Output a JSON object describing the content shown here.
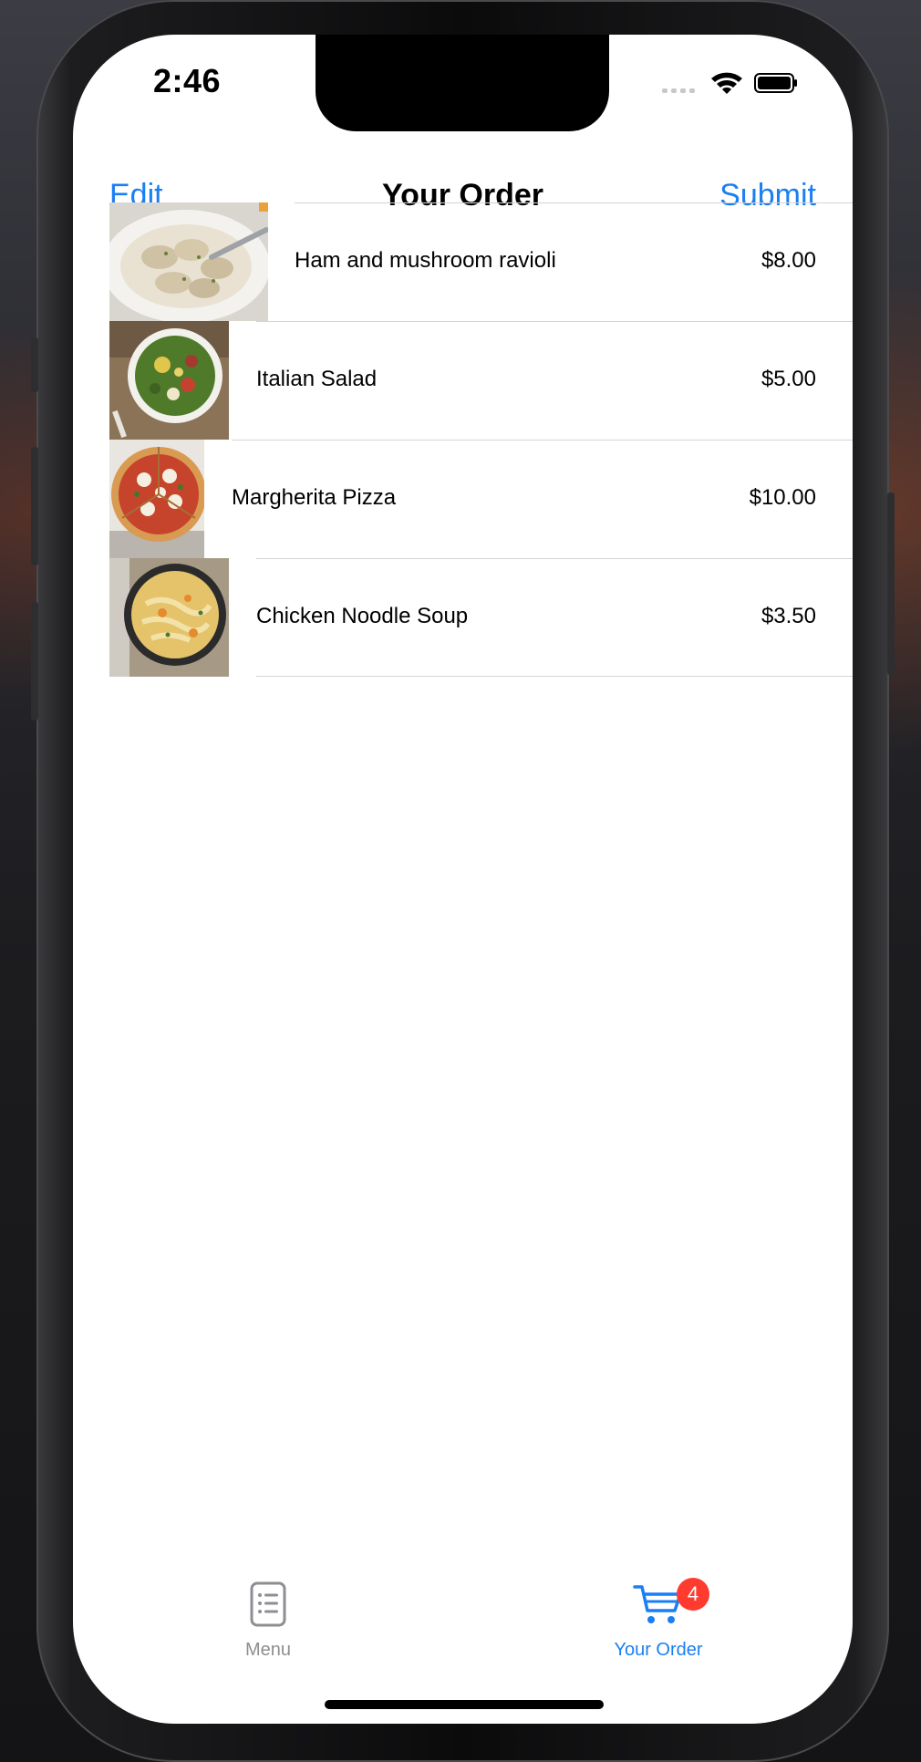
{
  "status_bar": {
    "time": "2:46"
  },
  "nav": {
    "edit_label": "Edit",
    "title": "Your Order",
    "submit_label": "Submit"
  },
  "order_items": [
    {
      "name": "Ham and mushroom ravioli",
      "price": "$8.00"
    },
    {
      "name": "Italian Salad",
      "price": "$5.00"
    },
    {
      "name": "Margherita Pizza",
      "price": "$10.00"
    },
    {
      "name": "Chicken Noodle Soup",
      "price": "$3.50"
    }
  ],
  "tab_bar": {
    "tabs": [
      {
        "label": "Menu",
        "icon": "menu-list-icon",
        "selected": false
      },
      {
        "label": "Your Order",
        "icon": "cart-icon",
        "selected": true,
        "badge": "4"
      }
    ]
  },
  "colors": {
    "accent": "#1a7ff2",
    "badge": "#ff3b30",
    "inactive_tab": "#8e8e93"
  }
}
